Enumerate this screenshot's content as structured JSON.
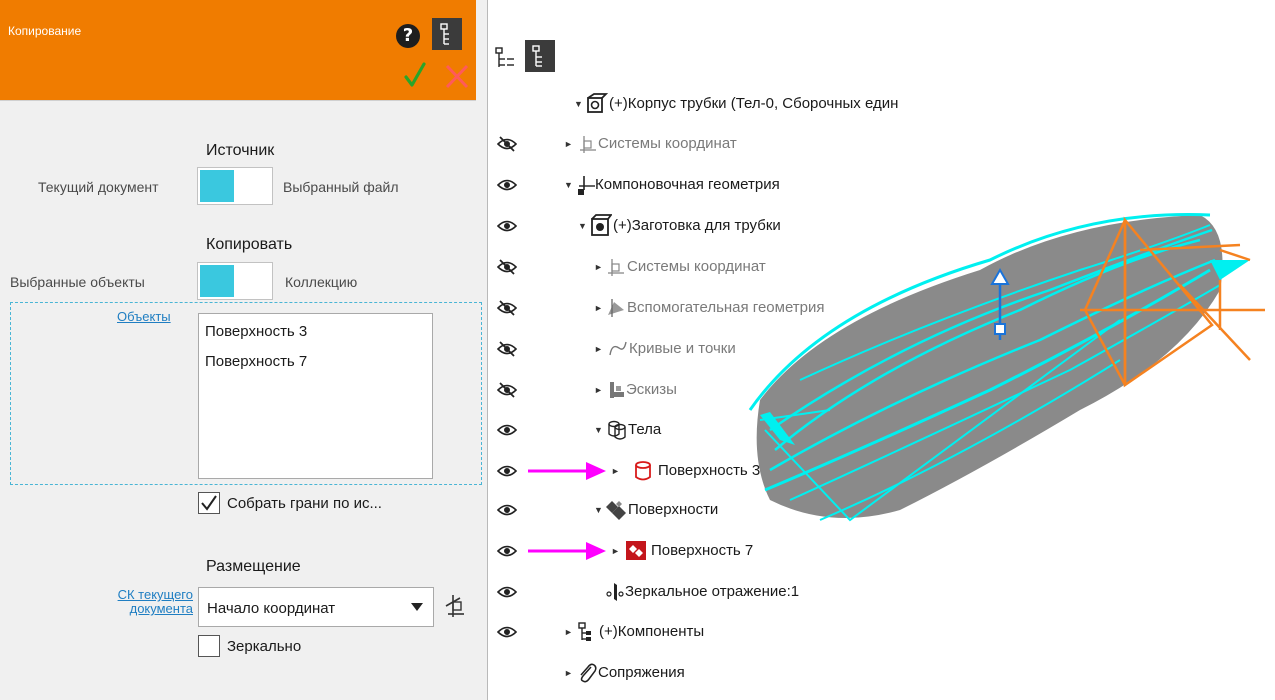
{
  "panel": {
    "title": "Копирование",
    "help_icon": "?",
    "source_title": "Источник",
    "source_left": "Текущий документ",
    "source_right": "Выбранный файл",
    "copy_title": "Копировать",
    "copy_left": "Выбранные объекты",
    "copy_right": "Коллекцию",
    "objects_link": "Объекты",
    "objects": [
      "Поверхность 3",
      "Поверхность 7"
    ],
    "collect_faces_label": "Собрать грани по ис...",
    "collect_faces_checked": true,
    "placement_title": "Размещение",
    "cs_link_line1": "СК текущего",
    "cs_link_line2": "документа",
    "cs_select_value": "Начало координат",
    "mirror_label": "Зеркально",
    "mirror_checked": false,
    "accent": "#f07c00",
    "toggle_color": "#3ac8df",
    "link_color": "#1f7ec2"
  },
  "tree": {
    "nodes": [
      {
        "label": "(+)Корпус трубки (Тел-0, Сборочных един",
        "icon": "assembly-icon",
        "visible": null
      },
      {
        "label": "Системы координат",
        "icon": "coordinate-systems-icon",
        "visible": false
      },
      {
        "label": "Компоновочная геометрия",
        "icon": "layout-geometry-icon",
        "visible": true
      },
      {
        "label": "(+)Заготовка для трубки",
        "icon": "part-icon",
        "visible": true
      },
      {
        "label": "Системы координат",
        "icon": "coordinate-systems-icon",
        "visible": false
      },
      {
        "label": "Вспомогательная геометрия",
        "icon": "auxiliary-geometry-icon",
        "visible": false
      },
      {
        "label": "Кривые и точки",
        "icon": "curves-icon",
        "visible": false
      },
      {
        "label": "Эскизы",
        "icon": "sketches-icon",
        "visible": false
      },
      {
        "label": "Тела",
        "icon": "bodies-icon",
        "visible": true
      },
      {
        "label": "Поверхность 3",
        "icon": "body-icon",
        "visible": true
      },
      {
        "label": "Поверхности",
        "icon": "surfaces-icon",
        "visible": true
      },
      {
        "label": "Поверхность 7",
        "icon": "surface-icon",
        "visible": true
      },
      {
        "label": "Зеркальное отражение:1",
        "icon": "mirror-icon",
        "visible": true
      },
      {
        "label": "(+)Компоненты",
        "icon": "components-icon",
        "visible": true
      },
      {
        "label": "Сопряжения",
        "icon": "mates-icon",
        "visible": null
      }
    ]
  },
  "colors": {
    "highlight_arrow": "#ff00ff",
    "wireframe": "#00f0f0",
    "orange_axes": "#f58220",
    "blue_handle": "#1a73d9"
  }
}
